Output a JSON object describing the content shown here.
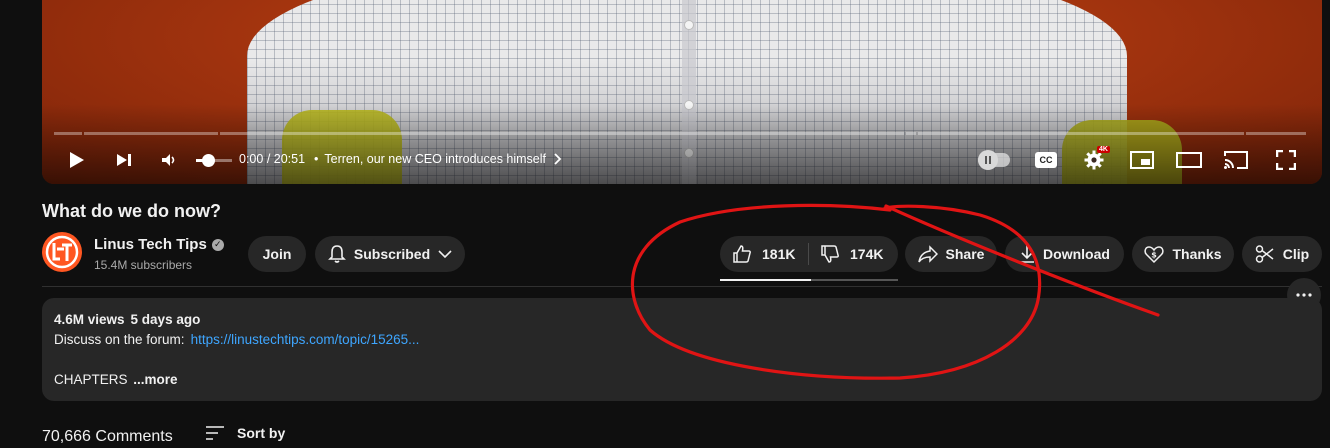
{
  "player": {
    "time_current": "0:00",
    "time_sep": " / ",
    "time_total": "20:51",
    "chapter_bullet": "•",
    "chapter_title": "Terren, our new CEO introduces himself",
    "cc_label": "CC",
    "quality_badge": "4K"
  },
  "video": {
    "title": "What do we do now?"
  },
  "channel": {
    "name": "Linus Tech Tips",
    "subscribers": "15.4M subscribers",
    "join_label": "Join",
    "subscribed_label": "Subscribed"
  },
  "actions": {
    "like_count": "181K",
    "dislike_count": "174K",
    "share_label": "Share",
    "download_label": "Download",
    "thanks_label": "Thanks",
    "clip_label": "Clip",
    "like_ratio": 0.51
  },
  "description": {
    "views": "4.6M views",
    "age": "5 days ago",
    "forum_text": "Discuss on the forum:",
    "forum_link": "https://linustechtips.com/topic/15265...",
    "chapters_visible": "CHAPTERS",
    "chapters_faded": " ",
    "more_label": "...more"
  },
  "comments": {
    "count_label": "70,666 Comments",
    "sort_label": "Sort by"
  },
  "colors": {
    "accent_link": "#3ea6ff",
    "annotation_red": "#e01414",
    "background": "#0f0f0f",
    "pill": "#272727"
  }
}
